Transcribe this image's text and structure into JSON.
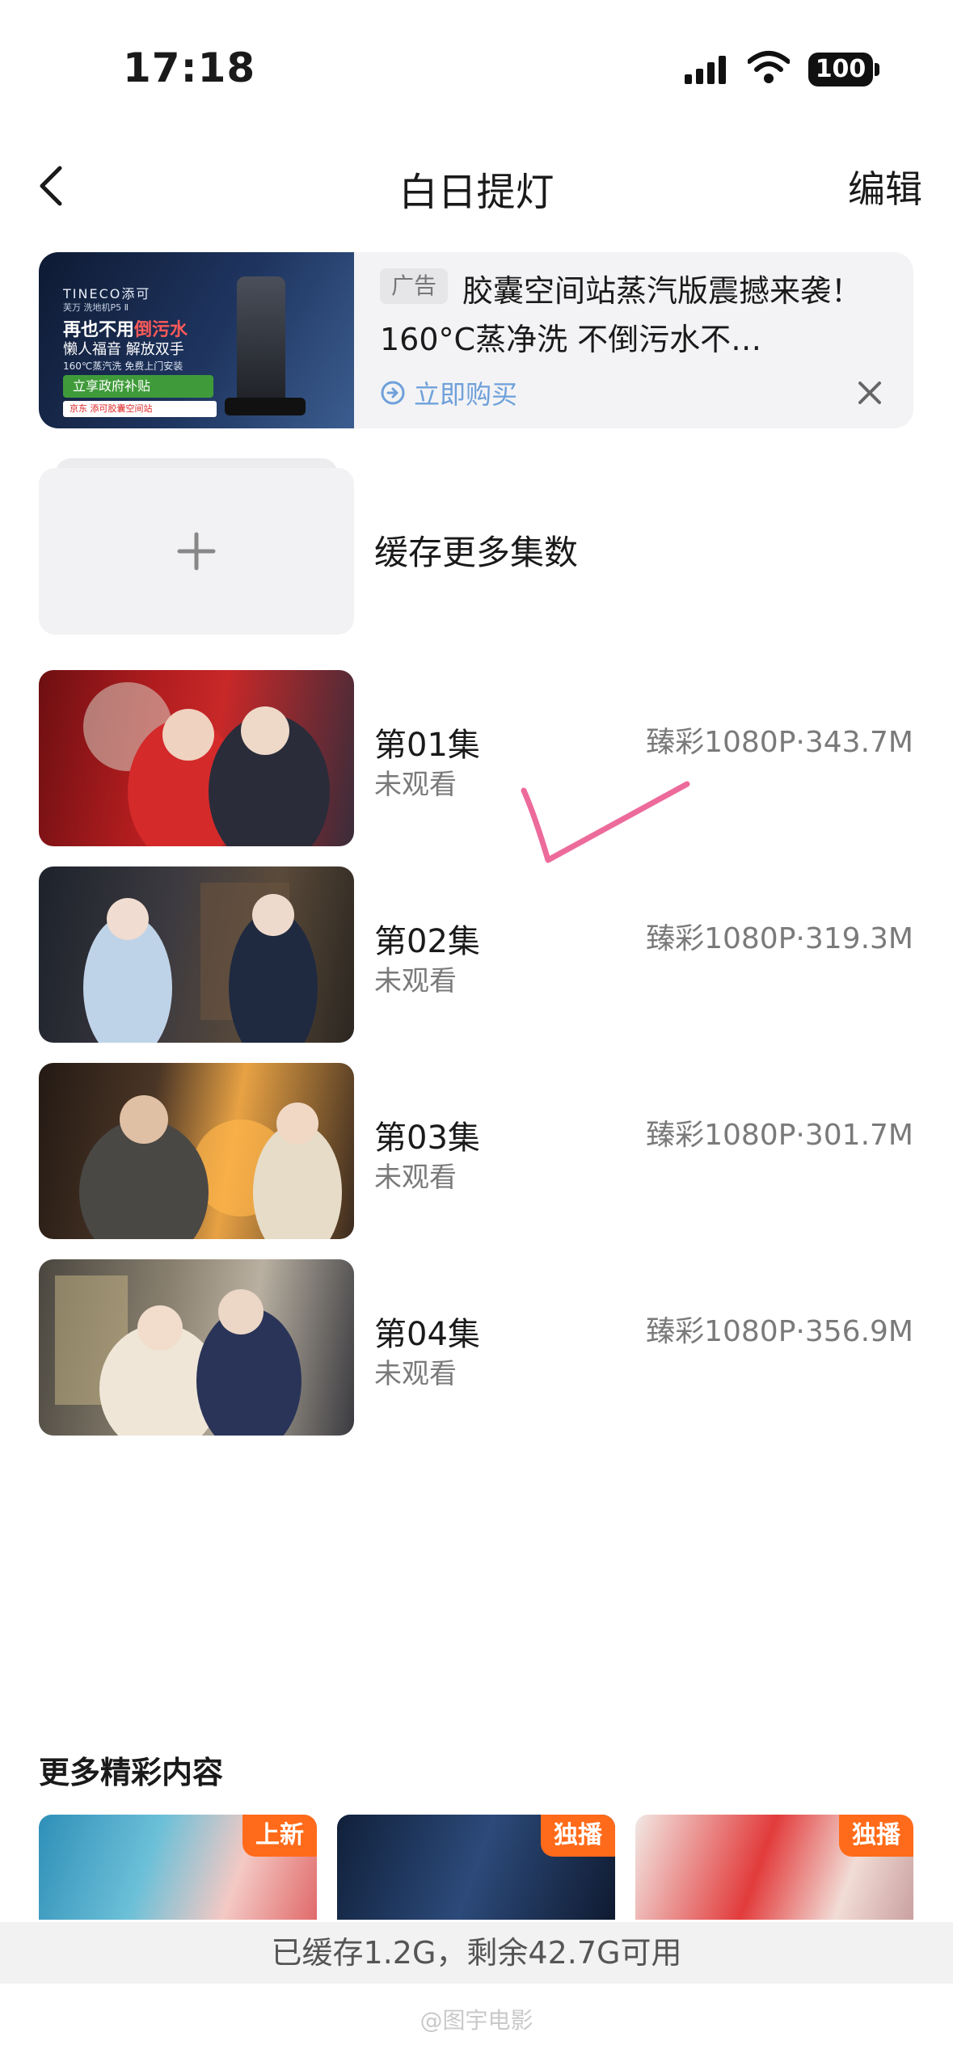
{
  "status_bar": {
    "time": "17:18",
    "battery": "100",
    "icons": [
      "signal-icon",
      "wifi-icon",
      "battery-icon"
    ]
  },
  "nav": {
    "back_icon": "chevron-left-icon",
    "title": "白日提灯",
    "edit": "编辑"
  },
  "ad": {
    "tag": "广告",
    "text": "胶囊空间站蒸汽版震撼来袭！160°C蒸净洗 不倒污水不…",
    "buy_label": "立即购买",
    "buy_icon": "arrow-circle-right-icon",
    "close_icon": "close-icon",
    "image": {
      "brand": "TINECO添可",
      "small": "芙万 洗地机P5 Ⅱ",
      "headline_prefix": "再也不用",
      "headline_emph": "倒污水",
      "sub": "懒人福音 解放双手",
      "tiny": "160℃蒸汽洗 免费上门安装",
      "pill": "立享政府补贴",
      "shop": "京东  添可胶囊空间站"
    }
  },
  "cache_more": {
    "icon": "plus-icon",
    "label": "缓存更多集数"
  },
  "episodes": [
    {
      "title": "第01集",
      "status": "未观看",
      "meta": "臻彩1080P·343.7M"
    },
    {
      "title": "第02集",
      "status": "未观看",
      "meta": "臻彩1080P·319.3M"
    },
    {
      "title": "第03集",
      "status": "未观看",
      "meta": "臻彩1080P·301.7M"
    },
    {
      "title": "第04集",
      "status": "未观看",
      "meta": "臻彩1080P·356.9M"
    }
  ],
  "more": {
    "heading": "更多精彩内容",
    "cards": [
      {
        "badge": "上新"
      },
      {
        "badge": "独播"
      },
      {
        "badge": "独播"
      }
    ]
  },
  "storage": "已缓存1.2G，剩余42.7G可用",
  "watermark": "@图宇电影",
  "colors": {
    "accent_blue": "#6ea0da",
    "badge_orange": "#ff6b1a",
    "annotation_pink": "#ec6b9b"
  }
}
